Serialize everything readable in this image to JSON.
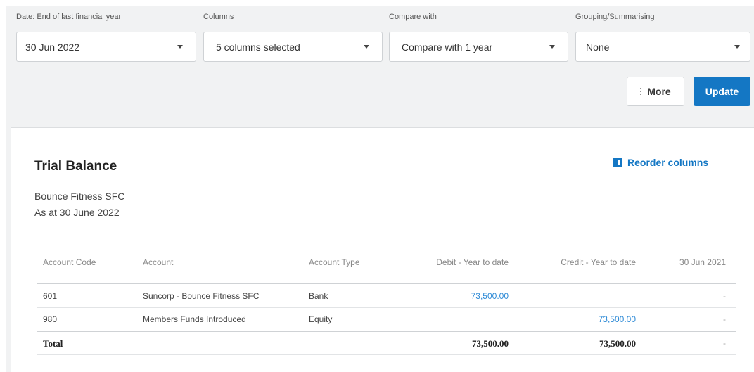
{
  "filters": {
    "date": {
      "label": "Date: End of last financial year",
      "value": "30 Jun 2022"
    },
    "columns": {
      "label": "Columns",
      "value": "5 columns selected"
    },
    "compare": {
      "label": "Compare with",
      "value": "Compare with 1 year"
    },
    "grouping": {
      "label": "Grouping/Summarising",
      "value": "None"
    }
  },
  "actions": {
    "more_label": "More",
    "update_label": "Update"
  },
  "report": {
    "title": "Trial Balance",
    "reorder_label": "Reorder columns",
    "org": "Bounce Fitness SFC",
    "as_at": "As at 30 June 2022"
  },
  "table": {
    "headers": [
      "Account Code",
      "Account",
      "Account Type",
      "Debit - Year to date",
      "Credit - Year to date",
      "30 Jun 2021"
    ],
    "rows": [
      {
        "code": "601",
        "account": "Suncorp - Bounce Fitness SFC",
        "type": "Bank",
        "debit": "73,500.00",
        "credit": "",
        "prior": "-"
      },
      {
        "code": "980",
        "account": "Members Funds Introduced",
        "type": "Equity",
        "debit": "",
        "credit": "73,500.00",
        "prior": "-"
      }
    ],
    "total": {
      "label": "Total",
      "debit": "73,500.00",
      "credit": "73,500.00",
      "prior": "-"
    }
  },
  "colors": {
    "accent": "#1477c4",
    "link": "#2d8ad6",
    "background": "#f1f2f3"
  }
}
